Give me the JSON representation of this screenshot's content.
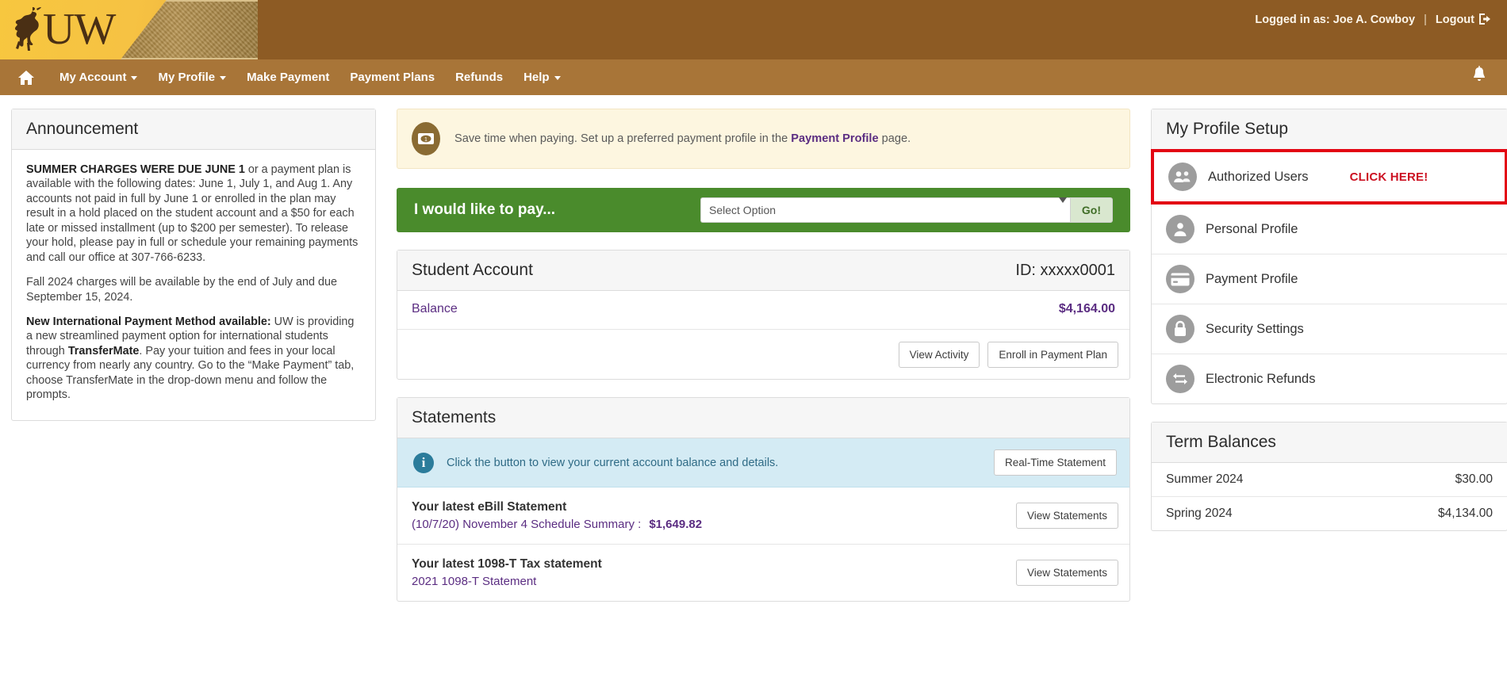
{
  "header": {
    "logo_text": "UW",
    "logo_icon": "bucking-horse-icon",
    "logged_in_label": "Logged in as: Joe A. Cowboy",
    "separator": "|",
    "logout_label": "Logout",
    "logout_icon": "logout-icon",
    "band_color": "#8d5b24"
  },
  "nav": {
    "home_icon": "home-icon",
    "bell_icon": "bell-icon",
    "bar_color": "#a87538",
    "items": [
      {
        "label": "My Account",
        "has_caret": true
      },
      {
        "label": "My Profile",
        "has_caret": true
      },
      {
        "label": "Make Payment",
        "has_caret": false
      },
      {
        "label": "Payment Plans",
        "has_caret": false
      },
      {
        "label": "Refunds",
        "has_caret": false
      },
      {
        "label": "Help",
        "has_caret": true
      }
    ]
  },
  "announcement": {
    "title": "Announcement",
    "para1_bold": "SUMMER CHARGES WERE DUE JUNE 1",
    "para1_rest": " or a payment plan is available with the following dates: June 1, July 1, and Aug 1. Any accounts not paid in full by June 1 or enrolled in the plan may result in a hold placed on the student account and a $50 for each late or missed installment (up to $200 per semester). To release your hold, please pay in full or schedule your remaining payments and call our office at 307-766-6233.",
    "para2": "Fall 2024 charges will be available by the end of July and due September 15, 2024.",
    "para3_bold": "New International Payment Method available:",
    "para3_a": " UW is providing a new streamlined payment option for international students through ",
    "para3_bold2": "TransferMate",
    "para3_b": ". Pay your tuition and fees in your local currency from nearly any country. Go to the “Make Payment” tab, choose TransferMate in the drop-down menu and follow the prompts."
  },
  "notice": {
    "icon": "dollar-bill-icon",
    "text_before": "Save time when paying. Set up a preferred payment profile in the ",
    "link": "Payment Profile",
    "text_after": " page.",
    "bg_color": "#fdf6e0"
  },
  "paybar": {
    "label": "I would like to pay...",
    "select_value": "Select Option",
    "options": [
      "Select Option"
    ],
    "go_label": "Go!",
    "bg_color": "#4a8b2c"
  },
  "student_account": {
    "title": "Student Account",
    "id_label": "ID: xxxxx0001",
    "balance_label": "Balance",
    "balance_value": "$4,164.00",
    "view_activity_label": "View Activity",
    "enroll_label": "Enroll in Payment Plan",
    "accent_color": "#5b2d82"
  },
  "statements": {
    "title": "Statements",
    "info_icon": "info-icon",
    "info_text": "Click the button to view your current account balance and details.",
    "realtime_label": "Real-Time Statement",
    "rows": [
      {
        "title": "Your latest eBill Statement",
        "subtitle": "(10/7/20) November 4 Schedule Summary :",
        "amount": "$1,649.82",
        "button": "View Statements"
      },
      {
        "title": "Your latest 1098-T Tax statement",
        "subtitle": "2021 1098-T Statement",
        "amount": "",
        "button": "View Statements"
      }
    ]
  },
  "profile_setup": {
    "title": "My Profile Setup",
    "highlight_color": "#e30613",
    "callout": "CLICK HERE!",
    "items": [
      {
        "label": "Authorized Users",
        "icon": "users-group-icon",
        "highlighted": true
      },
      {
        "label": "Personal Profile",
        "icon": "person-icon",
        "highlighted": false
      },
      {
        "label": "Payment Profile",
        "icon": "credit-card-icon",
        "highlighted": false
      },
      {
        "label": "Security Settings",
        "icon": "lock-icon",
        "highlighted": false
      },
      {
        "label": "Electronic Refunds",
        "icon": "refund-arrows-icon",
        "highlighted": false
      }
    ]
  },
  "term_balances": {
    "title": "Term Balances",
    "rows": [
      {
        "term": "Summer 2024",
        "amount": "$30.00"
      },
      {
        "term": "Spring 2024",
        "amount": "$4,134.00"
      }
    ]
  }
}
